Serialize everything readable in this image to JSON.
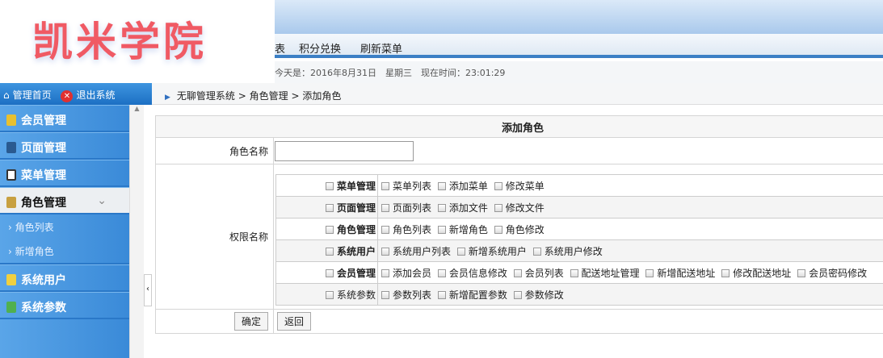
{
  "logo": {
    "text": "凯米学院"
  },
  "nav": {
    "items": [
      "表",
      "积分兑换",
      "刷新菜单"
    ]
  },
  "dateline": "今天是：2016年8月31日　星期三　现在时间：23:01:29",
  "lefthead": {
    "home": "管理首页",
    "logout": "退出系统"
  },
  "breadcrumb": [
    "无聊管理系统",
    "角色管理",
    "添加角色"
  ],
  "sidebar": {
    "items": [
      {
        "label": "会员管理"
      },
      {
        "label": "页面管理"
      },
      {
        "label": "菜单管理"
      },
      {
        "label": "角色管理",
        "active": true,
        "sub": [
          "角色列表",
          "新增角色"
        ]
      },
      {
        "label": "系统用户"
      },
      {
        "label": "系统参数"
      }
    ]
  },
  "form": {
    "title": "添加角色",
    "name_label": "角色名称",
    "name_value": "",
    "perm_label": "权限名称",
    "ok": "确定",
    "back": "返回",
    "groups": [
      {
        "name": "菜单管理",
        "items": [
          "菜单列表",
          "添加菜单",
          "修改菜单"
        ]
      },
      {
        "name": "页面管理",
        "items": [
          "页面列表",
          "添加文件",
          "修改文件"
        ]
      },
      {
        "name": "角色管理",
        "items": [
          "角色列表",
          "新增角色",
          "角色修改"
        ]
      },
      {
        "name": "系统用户",
        "items": [
          "系统用户列表",
          "新增系统用户",
          "系统用户修改"
        ]
      },
      {
        "name": "会员管理",
        "items": [
          "添加会员",
          "会员信息修改",
          "会员列表",
          "配送地址管理",
          "新增配送地址",
          "修改配送地址",
          "会员密码修改"
        ]
      },
      {
        "name": "系统参数",
        "items": [
          "参数列表",
          "新增配置参数",
          "参数修改"
        ]
      }
    ]
  }
}
